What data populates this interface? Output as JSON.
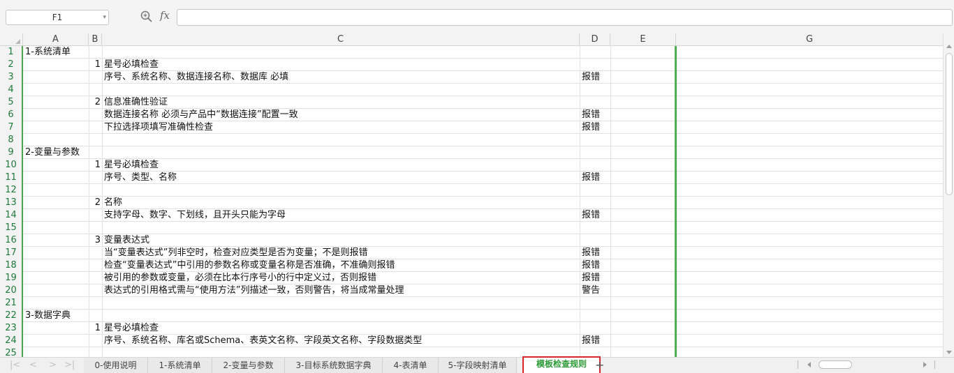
{
  "formula_bar": {
    "name_box": "F1",
    "fx_label": "fx",
    "formula": ""
  },
  "columns": [
    "A",
    "B",
    "C",
    "D",
    "E",
    "G"
  ],
  "rows": [
    {
      "n": "1",
      "a": "1-系统清单",
      "b": "",
      "c": "",
      "d": ""
    },
    {
      "n": "2",
      "a": "",
      "b": "1",
      "c": "星号必填检查",
      "d": ""
    },
    {
      "n": "3",
      "a": "",
      "b": "",
      "c": "序号、系统名称、数据连接名称、数据库 必填",
      "d": "报错"
    },
    {
      "n": "4",
      "a": "",
      "b": "",
      "c": "",
      "d": ""
    },
    {
      "n": "5",
      "a": "",
      "b": "2",
      "c": "信息准确性验证",
      "d": ""
    },
    {
      "n": "6",
      "a": "",
      "b": "",
      "c": "数据连接名称 必须与产品中“数据连接”配置一致",
      "d": "报错"
    },
    {
      "n": "7",
      "a": "",
      "b": "",
      "c": "下拉选择项填写准确性检查",
      "d": "报错"
    },
    {
      "n": "8",
      "a": "",
      "b": "",
      "c": "",
      "d": ""
    },
    {
      "n": "9",
      "a": "2-变量与参数",
      "b": "",
      "c": "",
      "d": ""
    },
    {
      "n": "10",
      "a": "",
      "b": "1",
      "c": "星号必填检查",
      "d": ""
    },
    {
      "n": "11",
      "a": "",
      "b": "",
      "c": "序号、类型、名称",
      "d": "报错"
    },
    {
      "n": "12",
      "a": "",
      "b": "",
      "c": "",
      "d": ""
    },
    {
      "n": "13",
      "a": "",
      "b": "2",
      "c": "名称",
      "d": ""
    },
    {
      "n": "14",
      "a": "",
      "b": "",
      "c": "支持字母、数字、下划线，且开头只能为字母",
      "d": "报错"
    },
    {
      "n": "15",
      "a": "",
      "b": "",
      "c": "",
      "d": ""
    },
    {
      "n": "16",
      "a": "",
      "b": "3",
      "c": "变量表达式",
      "d": ""
    },
    {
      "n": "17",
      "a": "",
      "b": "",
      "c": "当“变量表达式”列非空时，检查对应类型是否为变量；不是则报错",
      "d": "报错"
    },
    {
      "n": "18",
      "a": "",
      "b": "",
      "c": "检查“变量表达式”中引用的参数名称或变量名称是否准确，不准确则报错",
      "d": "报错"
    },
    {
      "n": "19",
      "a": "",
      "b": "",
      "c": "被引用的参数或变量，必须在比本行序号小的行中定义过，否则报错",
      "d": "报错"
    },
    {
      "n": "20",
      "a": "",
      "b": "",
      "c": "表达式的引用格式需与“使用方法”列描述一致，否则警告，将当成常量处理",
      "d": "警告"
    },
    {
      "n": "21",
      "a": "",
      "b": "",
      "c": "",
      "d": ""
    },
    {
      "n": "22",
      "a": "3-数据字典",
      "b": "",
      "c": "",
      "d": ""
    },
    {
      "n": "23",
      "a": "",
      "b": "1",
      "c": "星号必填检查",
      "d": ""
    },
    {
      "n": "24",
      "a": "",
      "b": "",
      "c": "序号、系统名称、库名或Schema、表英文名称、字段英文名称、字段数据类型",
      "d": "报错"
    },
    {
      "n": "25",
      "a": "",
      "b": "",
      "c": "",
      "d": ""
    }
  ],
  "sheet_tabs": [
    {
      "label": "0-使用说明",
      "active": false
    },
    {
      "label": "1-系统清单",
      "active": false
    },
    {
      "label": "2-变量与参数",
      "active": false
    },
    {
      "label": "3-目标系统数据字典",
      "active": false
    },
    {
      "label": "4-表清单",
      "active": false
    },
    {
      "label": "5-字段映射清单",
      "active": false
    },
    {
      "label": "模板检查规则",
      "active": true
    }
  ],
  "add_sheet_label": "+",
  "colors": {
    "accent_green": "#4caf50",
    "active_tab_border": "#d9262b",
    "active_tab_text": "#2e9b39"
  }
}
